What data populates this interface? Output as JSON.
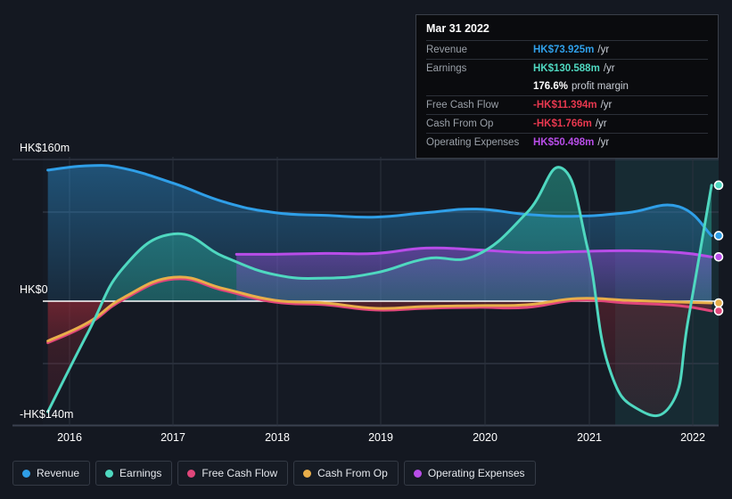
{
  "tooltip": {
    "title": "Mar 31 2022",
    "rows": [
      {
        "key": "Revenue",
        "value": "HK$73.925m",
        "suffix": "/yr",
        "color": "#2f9fe8"
      },
      {
        "key": "Earnings",
        "value": "HK$130.588m",
        "suffix": "/yr",
        "color": "#4fd8c0"
      },
      {
        "key": "Free Cash Flow",
        "value": "-HK$11.394m",
        "suffix": "/yr",
        "color": "#e8384f"
      },
      {
        "key": "Cash From Op",
        "value": "-HK$1.766m",
        "suffix": "/yr",
        "color": "#e8384f"
      },
      {
        "key": "Operating Expenses",
        "value": "HK$50.498m",
        "suffix": "/yr",
        "color": "#b84de8"
      }
    ],
    "profit_margin_value": "176.6%",
    "profit_margin_label": "profit margin"
  },
  "legend": [
    {
      "label": "Revenue",
      "color": "#2f9fe8"
    },
    {
      "label": "Earnings",
      "color": "#4fd8c0"
    },
    {
      "label": "Free Cash Flow",
      "color": "#e0467a"
    },
    {
      "label": "Cash From Op",
      "color": "#e8ae4a"
    },
    {
      "label": "Operating Expenses",
      "color": "#b84de8"
    }
  ],
  "axis": {
    "y_top_label": "HK$160m",
    "y_zero_label": "HK$0",
    "y_bottom_label": "-HK$140m",
    "x_ticks": [
      "2016",
      "2017",
      "2018",
      "2019",
      "2020",
      "2021",
      "2022"
    ]
  },
  "chart_data": {
    "type": "area",
    "title": "",
    "xlabel": "",
    "ylabel": "HK$",
    "currency": "HKD",
    "units": "millions",
    "ylim": [
      -140,
      160
    ],
    "xlim": [
      2015.6,
      2022.3
    ],
    "grid": true,
    "legend_position": "bottom",
    "gridlines_y": [
      160,
      90,
      0,
      -70,
      -140
    ],
    "forecast_start_x": 2021.15,
    "series": [
      {
        "name": "Revenue",
        "color": "#2f9fe8",
        "x": [
          2015.65,
          2016.05,
          2016.4,
          2016.9,
          2017.4,
          2017.9,
          2018.4,
          2018.9,
          2019.4,
          2019.9,
          2020.4,
          2020.9,
          2021.4,
          2021.9,
          2022.23
        ],
        "values": [
          148,
          153,
          150,
          133,
          112,
          100,
          97,
          95,
          100,
          104,
          98,
          96,
          100,
          107,
          74
        ]
      },
      {
        "name": "Earnings",
        "color": "#4fd8c0",
        "x": [
          2015.65,
          2016.05,
          2016.4,
          2016.9,
          2017.4,
          2017.9,
          2018.4,
          2018.9,
          2019.4,
          2019.9,
          2020.4,
          2020.75,
          2021.0,
          2021.2,
          2021.5,
          2021.85,
          2022.0,
          2022.23
        ],
        "values": [
          -125,
          -35,
          38,
          76,
          50,
          30,
          26,
          32,
          48,
          52,
          100,
          150,
          60,
          -70,
          -122,
          -113,
          -20,
          131
        ]
      },
      {
        "name": "Free Cash Flow",
        "color": "#e0467a",
        "x": [
          2015.65,
          2016.05,
          2016.4,
          2016.9,
          2017.4,
          2017.9,
          2018.4,
          2018.9,
          2019.4,
          2019.9,
          2020.4,
          2020.9,
          2021.4,
          2021.9,
          2022.23
        ],
        "values": [
          -47,
          -26,
          2,
          25,
          12,
          -1,
          -4,
          -10,
          -8,
          -7,
          -7,
          1,
          -2,
          -5,
          -11
        ]
      },
      {
        "name": "Cash From Op",
        "color": "#e8ae4a",
        "x": [
          2015.65,
          2016.05,
          2016.4,
          2016.9,
          2017.4,
          2017.9,
          2018.4,
          2018.9,
          2019.4,
          2019.9,
          2020.4,
          2020.9,
          2021.4,
          2021.9,
          2022.23
        ],
        "values": [
          -45,
          -24,
          4,
          27,
          14,
          1,
          -2,
          -8,
          -6,
          -5,
          -4,
          3,
          1,
          -1,
          -2
        ]
      },
      {
        "name": "Operating Expenses",
        "color": "#b84de8",
        "x": [
          2017.52,
          2017.9,
          2018.4,
          2018.9,
          2019.4,
          2019.9,
          2020.4,
          2020.9,
          2021.4,
          2021.9,
          2022.23
        ],
        "values": [
          53,
          53,
          54,
          54,
          60,
          58,
          55,
          56,
          57,
          55,
          50
        ]
      }
    ],
    "endpoints": [
      {
        "name": "Earnings",
        "value": 131,
        "color": "#4fd8c0"
      },
      {
        "name": "Revenue",
        "value": 74,
        "color": "#2f9fe8"
      },
      {
        "name": "Operating Expenses",
        "value": 50,
        "color": "#b84de8"
      },
      {
        "name": "Cash From Op",
        "value": -2,
        "color": "#e8ae4a"
      },
      {
        "name": "Free Cash Flow",
        "value": -11,
        "color": "#e0467a"
      }
    ]
  }
}
